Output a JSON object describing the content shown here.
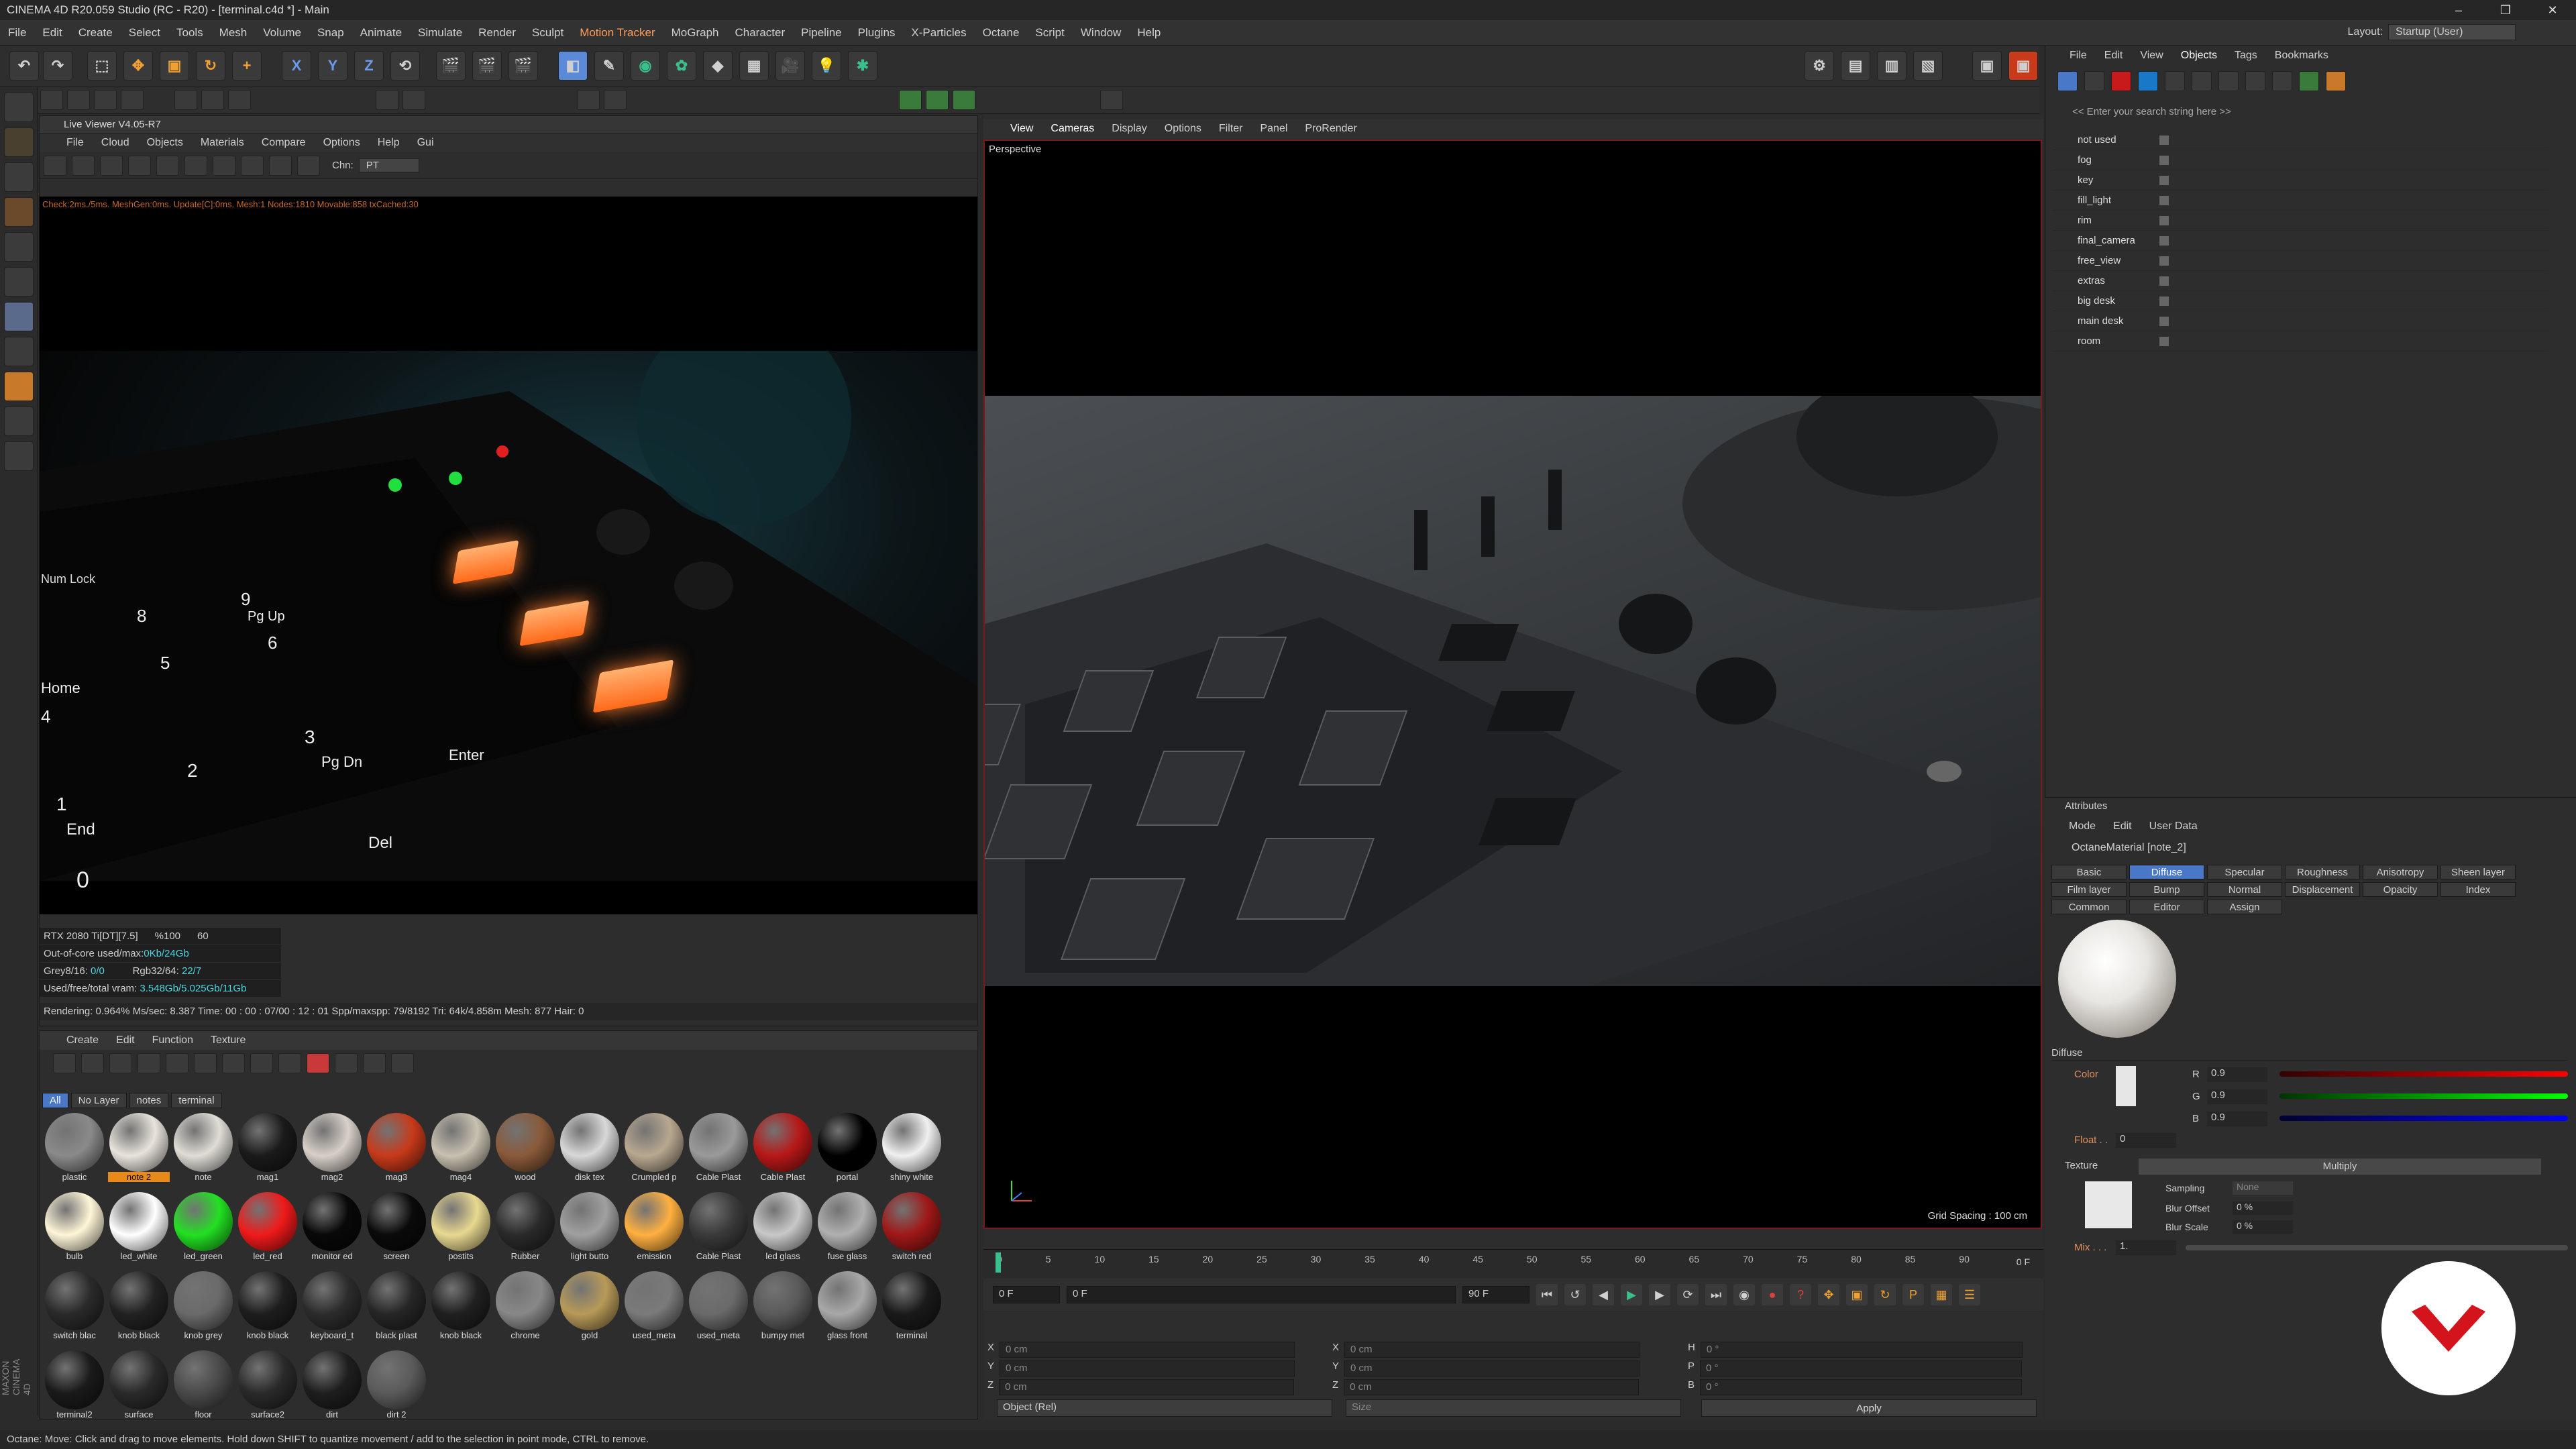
{
  "title": "CINEMA 4D R20.059 Studio (RC - R20) - [terminal.c4d *] - Main",
  "menu": [
    "File",
    "Edit",
    "Create",
    "Select",
    "Tools",
    "Mesh",
    "Volume",
    "Snap",
    "Animate",
    "Simulate",
    "Render",
    "Sculpt",
    "Motion Tracker",
    "MoGraph",
    "Character",
    "Pipeline",
    "Plugins",
    "X-Particles",
    "Octane",
    "Script",
    "Window",
    "Help"
  ],
  "layout_label": "Layout:",
  "layout_value": "Startup (User)",
  "toolbar_axes": [
    "X",
    "Y",
    "Z"
  ],
  "live_viewer": {
    "title": "Live Viewer V4.05-R7",
    "menu": [
      "File",
      "Cloud",
      "Objects",
      "Materials",
      "Compare",
      "Options",
      "Help",
      "Gui"
    ],
    "chn_label": "Chn:",
    "chn_value": "PT",
    "check_line": "Check:2ms./5ms. MeshGen:0ms. Update[C]:0ms. Mesh:1 Nodes:1810 Movable:858 txCached:30",
    "stats": [
      {
        "a": "RTX 2080 Ti[DT][7.5]",
        "b": "%100",
        "c": "60"
      },
      {
        "a": "Out-of-core used/max:",
        "b": "0Kb/24Gb"
      },
      {
        "a": "Grey8/16:",
        "b": "0/0",
        "c": "Rgb32/64:",
        "d": "22/7"
      },
      {
        "a": "Used/free/total vram:",
        "b": "3.548Gb/5.025Gb/11Gb"
      }
    ],
    "render_line": "Rendering: 0.964%   Ms/sec: 8.387   Time: 00 : 00 : 07/00 : 12 : 01   Spp/maxspp: 79/8192   Tri: 64k/4.858m   Mesh: 877   Hair: 0",
    "keys": [
      "Num Lock",
      "9",
      "Pg Up",
      "8",
      "5",
      "6",
      "Home",
      "4",
      "2",
      "3",
      "Pg Dn",
      "Enter",
      "1",
      "End",
      "Del",
      "0"
    ]
  },
  "viewport": {
    "menu": [
      "View",
      "Cameras",
      "Display",
      "Options",
      "Filter",
      "Panel",
      "ProRender"
    ],
    "label": "Perspective",
    "grid": "Grid Spacing : 100 cm"
  },
  "timeline": {
    "ticks": [
      "0",
      "5",
      "10",
      "15",
      "20",
      "25",
      "30",
      "35",
      "40",
      "45",
      "50",
      "55",
      "60",
      "65",
      "70",
      "75",
      "80",
      "85",
      "90"
    ],
    "end": "0 F",
    "start_field": "0 F",
    "min_field": "0 F",
    "max_field": "90 F",
    "end_field": "90 F"
  },
  "coords": {
    "x": "X",
    "y": "Y",
    "z": "Z",
    "h": "H",
    "p": "P",
    "b": "B",
    "val": "0 cm",
    "ang": "0 °",
    "mode": "Object (Rel)",
    "size": "Size",
    "apply": "Apply"
  },
  "material_manager": {
    "menu": [
      "Create",
      "Edit",
      "Function",
      "Texture"
    ],
    "tabs": [
      "All",
      "No Layer",
      "notes",
      "terminal"
    ],
    "materials": [
      {
        "n": "plastic",
        "c": "#8a8a8a"
      },
      {
        "n": "note 2",
        "c": "#e8e4dc",
        "sel": true
      },
      {
        "n": "note",
        "c": "#e0ddd6"
      },
      {
        "n": "mag1",
        "c": "#1a1a1a"
      },
      {
        "n": "mag2",
        "c": "#d8d0c8"
      },
      {
        "n": "mag3",
        "c": "#c83a1a"
      },
      {
        "n": "mag4",
        "c": "#c8c0b0"
      },
      {
        "n": "wood",
        "c": "#8a5a3a"
      },
      {
        "n": "disk tex",
        "c": "#d8d8d8"
      },
      {
        "n": "Crumpled p",
        "c": "#b8a890"
      },
      {
        "n": "Cable Plast",
        "c": "#9a9a9a"
      },
      {
        "n": "Cable Plast",
        "c": "#b81818"
      },
      {
        "n": "portal",
        "c": "#000000"
      },
      {
        "n": "shiny white",
        "c": "#f0f0f0"
      },
      {
        "n": "bulb",
        "c": "#fff6d8"
      },
      {
        "n": "led_white",
        "c": "#ffffff"
      },
      {
        "n": "led_green",
        "c": "#22e022"
      },
      {
        "n": "led_red",
        "c": "#f01a1a"
      },
      {
        "n": "monitor ed",
        "c": "#080808"
      },
      {
        "n": "screen",
        "c": "#0a0a0a"
      },
      {
        "n": "postits",
        "c": "#e8d890"
      },
      {
        "n": "Rubber",
        "c": "#2a2a2a"
      },
      {
        "n": "light butto",
        "c": "#a0a0a0"
      },
      {
        "n": "emission",
        "c": "#ffb040"
      },
      {
        "n": "Cable Plast",
        "c": "#3a3a3a"
      },
      {
        "n": "led glass",
        "c": "#c8c8c8"
      },
      {
        "n": "fuse glass",
        "c": "#b0b0b0"
      },
      {
        "n": "switch red",
        "c": "#a01818"
      },
      {
        "n": "switch blac",
        "c": "#2a2a2a"
      },
      {
        "n": "knob black",
        "c": "#222222"
      },
      {
        "n": "knob grey",
        "c": "#6a6a6a"
      },
      {
        "n": "knob black",
        "c": "#1e1e1e"
      },
      {
        "n": "keyboard_t",
        "c": "#2c2c2c"
      },
      {
        "n": "black plast",
        "c": "#262626"
      },
      {
        "n": "knob black",
        "c": "#202020"
      },
      {
        "n": "chrome",
        "c": "#888888"
      },
      {
        "n": "gold",
        "c": "#b89a58"
      },
      {
        "n": "used_meta",
        "c": "#7a7a7a"
      },
      {
        "n": "used_meta",
        "c": "#6a6a6a"
      },
      {
        "n": "bumpy met",
        "c": "#5a5a5a"
      },
      {
        "n": "glass front",
        "c": "#a8a8a8"
      },
      {
        "n": "terminal",
        "c": "#1a1a1a"
      },
      {
        "n": "terminal2",
        "c": "#1a1a1a"
      },
      {
        "n": "surface",
        "c": "#2a2a2a"
      },
      {
        "n": "floor",
        "c": "#4a4a4a"
      },
      {
        "n": "surface2",
        "c": "#2a2a2a"
      },
      {
        "n": "dirt",
        "c": "#1e1e1e"
      },
      {
        "n": "dirt 2",
        "c": "#5a5a5a"
      }
    ]
  },
  "objects": {
    "menu": [
      "File",
      "Edit",
      "View",
      "Objects",
      "Tags",
      "Bookmarks"
    ],
    "search": "<< Enter your search string here >>",
    "items": [
      "not used",
      "fog",
      "key",
      "fill_light",
      "rim",
      "final_camera",
      "free_view",
      "extras",
      "big desk",
      "main desk",
      "room"
    ]
  },
  "attributes": {
    "title": "Attributes",
    "menu": [
      "Mode",
      "Edit",
      "User Data"
    ],
    "material": "OctaneMaterial [note_2]",
    "tabs": [
      "Basic",
      "Diffuse",
      "Specular",
      "Roughness",
      "Anisotropy",
      "Sheen layer",
      "Film layer",
      "Bump",
      "Normal",
      "Displacement",
      "Opacity",
      "Index",
      "Common",
      "Editor",
      "Assign"
    ],
    "section": "Diffuse",
    "color_label": "Color",
    "r": "R",
    "g": "G",
    "b": "B",
    "rv": "0.9",
    "gv": "0.9",
    "bv": "0.9",
    "float_label": "Float . .",
    "float_val": "0",
    "texture_label": "Texture",
    "multiply": "Multiply",
    "sampling": "Sampling",
    "sampling_val": "None",
    "blur_offset": "Blur Offset",
    "blur_offset_val": "0 %",
    "blur_scale": "Blur Scale",
    "blur_scale_val": "0 %",
    "mix_label": "Mix . . .",
    "mix_val": "1."
  },
  "status": "Octane:      Move: Click and drag to move elements. Hold down SHIFT to quantize movement / add to the selection in point mode, CTRL to remove.",
  "brand": "MAXON CINEMA 4D"
}
